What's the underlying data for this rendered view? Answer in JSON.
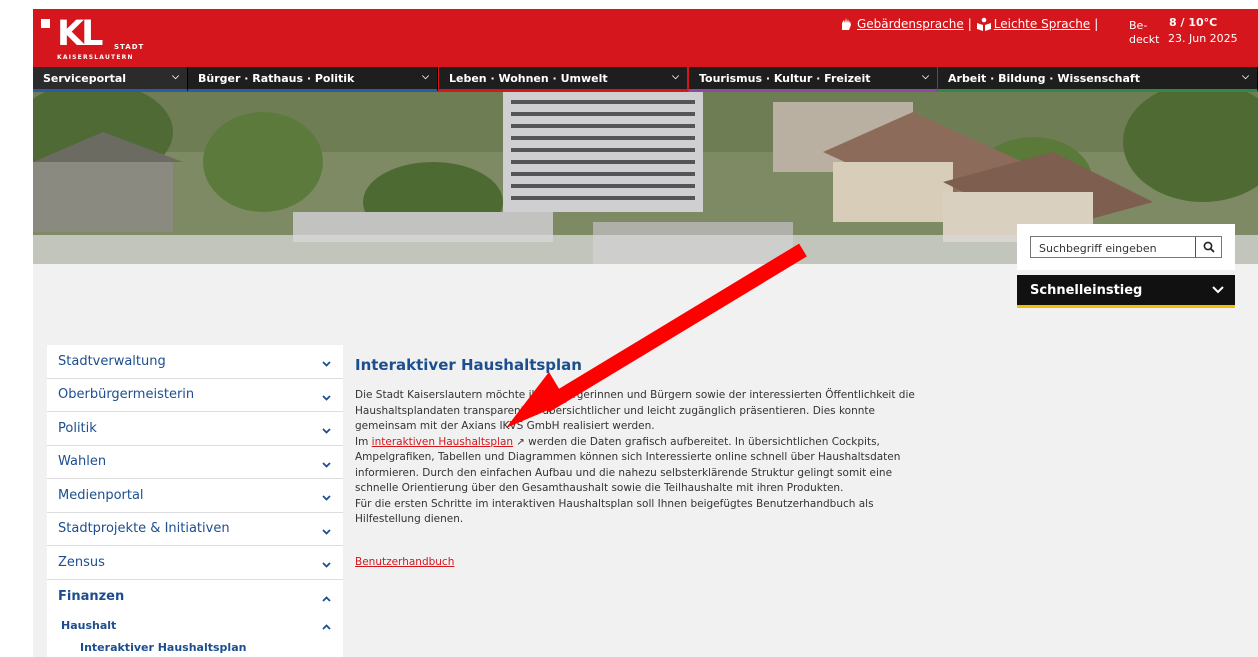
{
  "header": {
    "logo_letters": "KL",
    "logo_stadt": "STADT",
    "logo_city": "KAISERSLAUTERN",
    "sign_language": "Gebärdensprache",
    "easy_language": "Leichte Sprache",
    "separator": "|",
    "weather_condition": "Be-\ndeckt",
    "weather_temp": "8 / 10°C",
    "weather_date": "23. Jun 2025"
  },
  "nav": {
    "items": [
      {
        "label": "Serviceportal"
      },
      {
        "label": "Bürger · Rathaus · Politik"
      },
      {
        "label": "Leben · Wohnen · Umwelt"
      },
      {
        "label": "Tourismus · Kultur · Freizeit"
      },
      {
        "label": "Arbeit · Bildung · Wissenschaft"
      }
    ]
  },
  "search": {
    "placeholder": "Suchbegriff eingeben"
  },
  "quickaccess": {
    "label": "Schnelleinstieg"
  },
  "sidebar": {
    "items": [
      {
        "label": "Stadtverwaltung"
      },
      {
        "label": "Oberbürgermeisterin"
      },
      {
        "label": "Politik"
      },
      {
        "label": "Wahlen"
      },
      {
        "label": "Medienportal"
      },
      {
        "label": "Stadtprojekte & Initiativen"
      },
      {
        "label": "Zensus"
      },
      {
        "label": "Finanzen"
      }
    ],
    "sub_label": "Haushalt",
    "subsub_label": "Interaktiver Haushaltsplan"
  },
  "main": {
    "title": "Interaktiver Haushaltsplan",
    "para1": "Die Stadt Kaiserslautern möchte ihren Bürgerinnen und Bürgern sowie der interessierten Öffentlichkeit die Haushaltsplandaten transparenter, übersichtlicher und leicht zugänglich präsentieren. Dies konnte gemeinsam mit der Axians IKVS GmbH realisiert werden.",
    "para2_pre": "Im ",
    "para2_link": "interaktiven Haushaltsplan",
    "para2_post": " werden die Daten grafisch aufbereitet. In übersichtlichen Cockpits, Ampelgrafiken, Tabellen und Diagrammen können sich Interessierte online schnell über Haushaltsdaten informieren. Durch den einfachen Aufbau und die nahezu selbsterklärende Struktur gelingt somit eine schnelle Orientierung über den Gesamthaushalt sowie die Teilhaushalte mit ihren Produkten.",
    "para3": "Für die ersten Schritte im interaktiven Haushaltsplan soll Ihnen beigefügtes Benutzerhandbuch als Hilfestellung dienen.",
    "handbook_link": "Benutzerhandbuch"
  },
  "colors": {
    "brand_red": "#d5161c",
    "link_blue": "#1d4e8f",
    "nav_dark": "#1e1e1e",
    "quick_yellow": "#f0c000"
  }
}
